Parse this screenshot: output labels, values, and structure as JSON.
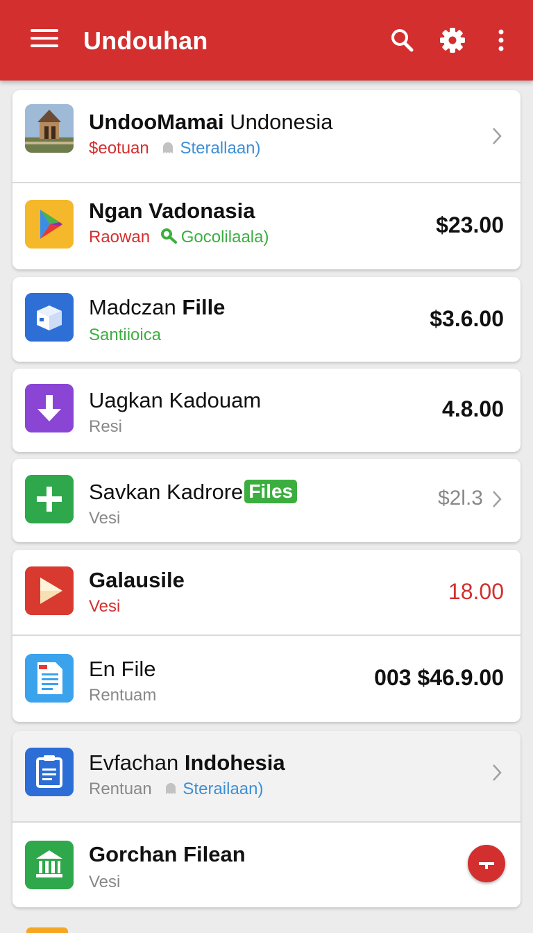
{
  "app_bar": {
    "title": "Undouhan",
    "color": "#d32f2f",
    "icons": [
      "menu-icon",
      "search-icon",
      "gear-icon",
      "more-vert-icon"
    ]
  },
  "items": [
    {
      "name_bold": "UndooMamai",
      "name_regular": " Undonesia",
      "sub_red": "$eotuan",
      "sub_blue": "Sterallaan)",
      "icon": "building-photo-icon"
    },
    {
      "name_bold": "Ngan Vadonasia",
      "sub_red": "Raowan",
      "sub_green": "Gocolilaala)",
      "price": "$23.00",
      "icon": "play-store-icon"
    },
    {
      "name_regular": "Madczan ",
      "name_bold": "Fille",
      "sub_green": "Santiioica",
      "price": "$3.6.00",
      "icon": "box-icon"
    },
    {
      "name_regular": "Uagkan Kadouam",
      "sub": "Resi",
      "price": "4.8.00",
      "icon": "download-arrow-icon"
    },
    {
      "name_regular": "Savkan Kadrore",
      "badge": "Files",
      "sub": "Vesi",
      "price": "$2l.3",
      "icon": "plus-icon"
    },
    {
      "name_bold": "Galausile",
      "sub_red": "Vesi",
      "price": "18.00",
      "icon": "play-triangle-icon"
    },
    {
      "name_regular": "En File",
      "sub": "Rentuam",
      "price": "003 $46.9.00",
      "icon": "document-icon"
    },
    {
      "name_regular": "Evfachan ",
      "name_bold": "Indohesia",
      "sub": "Rentuan",
      "sub_blue": "Sterailaan)",
      "icon": "clipboard-icon"
    },
    {
      "name_bold": "Gorchan Filean",
      "sub": "Vesi",
      "icon": "bank-icon"
    }
  ],
  "colors": {
    "red": "#d32f2f",
    "green": "#3cae3f",
    "blue": "#3d8fd6",
    "grey_text": "#888888"
  }
}
